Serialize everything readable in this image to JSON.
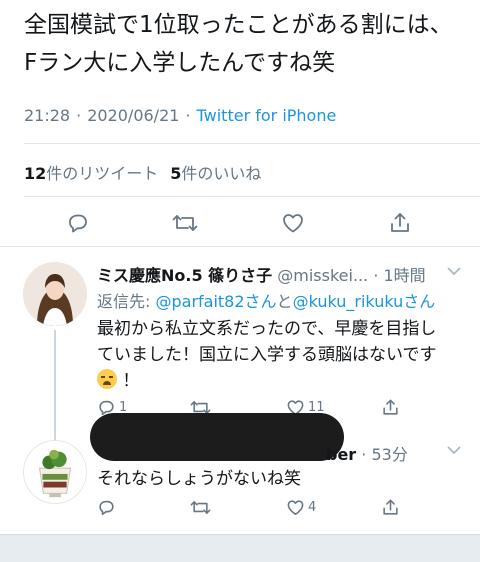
{
  "tweet": {
    "text": "全国模試で1位取ったことがある割には、Fラン大に入学したんですね笑",
    "time": "21:28",
    "separator": "·",
    "date": "2020/06/21",
    "source": "Twitter for iPhone"
  },
  "stats": {
    "retweet_count": "12",
    "retweet_label": "件のリツイート",
    "like_count": "5",
    "like_label": "件のいいね"
  },
  "actions": [
    "reply-icon",
    "retweet-icon",
    "like-icon",
    "share-icon"
  ],
  "replies": [
    {
      "name": "ミス慶應No.5 篠りさ子",
      "handle": "@misskei...",
      "dot": "·",
      "time": "1時間",
      "reply_prefix": "返信先: ",
      "reply_user1": "@parfait82さん",
      "reply_and": "と",
      "reply_user2": "@kuku_rikukuさん",
      "text_line1": "最初から私立文系だったので、早慶を目指し",
      "text_line2": "ていました！国立に入学する頭脳はないです",
      "text_line3": "！",
      "emoji": "loudly-crying-face",
      "reply_count": "1",
      "retweet_count": "",
      "like_count": "11"
    },
    {
      "name_visible": "ber",
      "dot": "·",
      "time": "53分",
      "text": "それならしょうがないね笑",
      "reply_count": "",
      "retweet_count": "",
      "like_count": "4"
    }
  ],
  "colors": {
    "link": "#1b95e0",
    "secondary": "#657786",
    "divider": "#e1e8ed",
    "redaction": "#1c1c1c"
  }
}
